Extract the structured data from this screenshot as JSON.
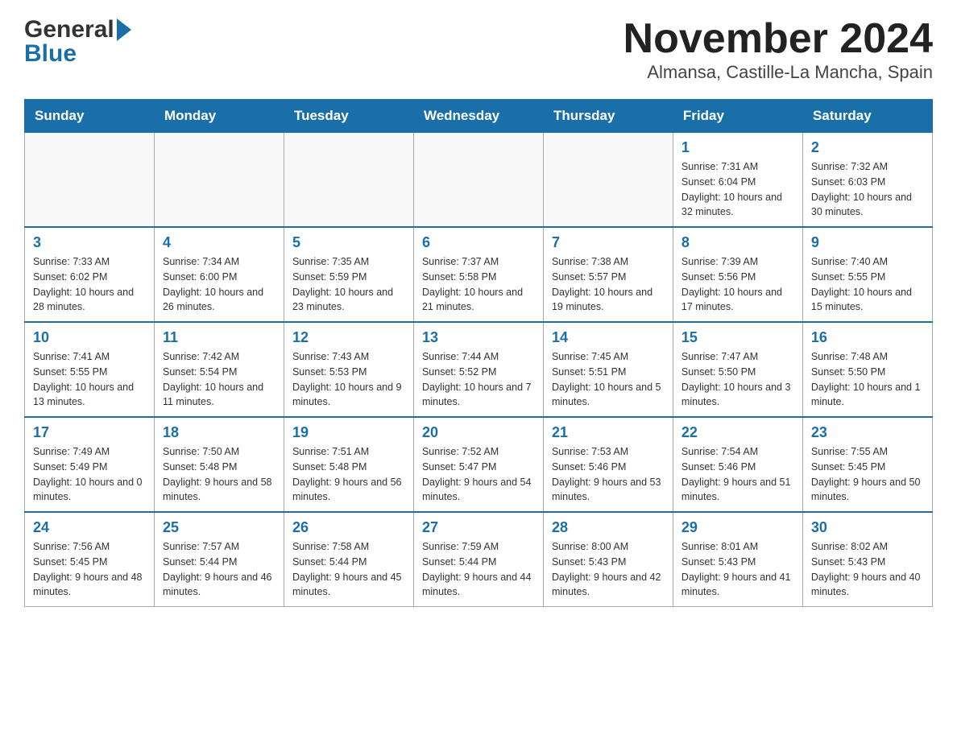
{
  "header": {
    "logo_general": "General",
    "logo_blue": "Blue",
    "title": "November 2024",
    "subtitle": "Almansa, Castille-La Mancha, Spain"
  },
  "weekdays": [
    "Sunday",
    "Monday",
    "Tuesday",
    "Wednesday",
    "Thursday",
    "Friday",
    "Saturday"
  ],
  "weeks": [
    [
      {
        "day": "",
        "info": ""
      },
      {
        "day": "",
        "info": ""
      },
      {
        "day": "",
        "info": ""
      },
      {
        "day": "",
        "info": ""
      },
      {
        "day": "",
        "info": ""
      },
      {
        "day": "1",
        "info": "Sunrise: 7:31 AM\nSunset: 6:04 PM\nDaylight: 10 hours and 32 minutes."
      },
      {
        "day": "2",
        "info": "Sunrise: 7:32 AM\nSunset: 6:03 PM\nDaylight: 10 hours and 30 minutes."
      }
    ],
    [
      {
        "day": "3",
        "info": "Sunrise: 7:33 AM\nSunset: 6:02 PM\nDaylight: 10 hours and 28 minutes."
      },
      {
        "day": "4",
        "info": "Sunrise: 7:34 AM\nSunset: 6:00 PM\nDaylight: 10 hours and 26 minutes."
      },
      {
        "day": "5",
        "info": "Sunrise: 7:35 AM\nSunset: 5:59 PM\nDaylight: 10 hours and 23 minutes."
      },
      {
        "day": "6",
        "info": "Sunrise: 7:37 AM\nSunset: 5:58 PM\nDaylight: 10 hours and 21 minutes."
      },
      {
        "day": "7",
        "info": "Sunrise: 7:38 AM\nSunset: 5:57 PM\nDaylight: 10 hours and 19 minutes."
      },
      {
        "day": "8",
        "info": "Sunrise: 7:39 AM\nSunset: 5:56 PM\nDaylight: 10 hours and 17 minutes."
      },
      {
        "day": "9",
        "info": "Sunrise: 7:40 AM\nSunset: 5:55 PM\nDaylight: 10 hours and 15 minutes."
      }
    ],
    [
      {
        "day": "10",
        "info": "Sunrise: 7:41 AM\nSunset: 5:55 PM\nDaylight: 10 hours and 13 minutes."
      },
      {
        "day": "11",
        "info": "Sunrise: 7:42 AM\nSunset: 5:54 PM\nDaylight: 10 hours and 11 minutes."
      },
      {
        "day": "12",
        "info": "Sunrise: 7:43 AM\nSunset: 5:53 PM\nDaylight: 10 hours and 9 minutes."
      },
      {
        "day": "13",
        "info": "Sunrise: 7:44 AM\nSunset: 5:52 PM\nDaylight: 10 hours and 7 minutes."
      },
      {
        "day": "14",
        "info": "Sunrise: 7:45 AM\nSunset: 5:51 PM\nDaylight: 10 hours and 5 minutes."
      },
      {
        "day": "15",
        "info": "Sunrise: 7:47 AM\nSunset: 5:50 PM\nDaylight: 10 hours and 3 minutes."
      },
      {
        "day": "16",
        "info": "Sunrise: 7:48 AM\nSunset: 5:50 PM\nDaylight: 10 hours and 1 minute."
      }
    ],
    [
      {
        "day": "17",
        "info": "Sunrise: 7:49 AM\nSunset: 5:49 PM\nDaylight: 10 hours and 0 minutes."
      },
      {
        "day": "18",
        "info": "Sunrise: 7:50 AM\nSunset: 5:48 PM\nDaylight: 9 hours and 58 minutes."
      },
      {
        "day": "19",
        "info": "Sunrise: 7:51 AM\nSunset: 5:48 PM\nDaylight: 9 hours and 56 minutes."
      },
      {
        "day": "20",
        "info": "Sunrise: 7:52 AM\nSunset: 5:47 PM\nDaylight: 9 hours and 54 minutes."
      },
      {
        "day": "21",
        "info": "Sunrise: 7:53 AM\nSunset: 5:46 PM\nDaylight: 9 hours and 53 minutes."
      },
      {
        "day": "22",
        "info": "Sunrise: 7:54 AM\nSunset: 5:46 PM\nDaylight: 9 hours and 51 minutes."
      },
      {
        "day": "23",
        "info": "Sunrise: 7:55 AM\nSunset: 5:45 PM\nDaylight: 9 hours and 50 minutes."
      }
    ],
    [
      {
        "day": "24",
        "info": "Sunrise: 7:56 AM\nSunset: 5:45 PM\nDaylight: 9 hours and 48 minutes."
      },
      {
        "day": "25",
        "info": "Sunrise: 7:57 AM\nSunset: 5:44 PM\nDaylight: 9 hours and 46 minutes."
      },
      {
        "day": "26",
        "info": "Sunrise: 7:58 AM\nSunset: 5:44 PM\nDaylight: 9 hours and 45 minutes."
      },
      {
        "day": "27",
        "info": "Sunrise: 7:59 AM\nSunset: 5:44 PM\nDaylight: 9 hours and 44 minutes."
      },
      {
        "day": "28",
        "info": "Sunrise: 8:00 AM\nSunset: 5:43 PM\nDaylight: 9 hours and 42 minutes."
      },
      {
        "day": "29",
        "info": "Sunrise: 8:01 AM\nSunset: 5:43 PM\nDaylight: 9 hours and 41 minutes."
      },
      {
        "day": "30",
        "info": "Sunrise: 8:02 AM\nSunset: 5:43 PM\nDaylight: 9 hours and 40 minutes."
      }
    ]
  ]
}
